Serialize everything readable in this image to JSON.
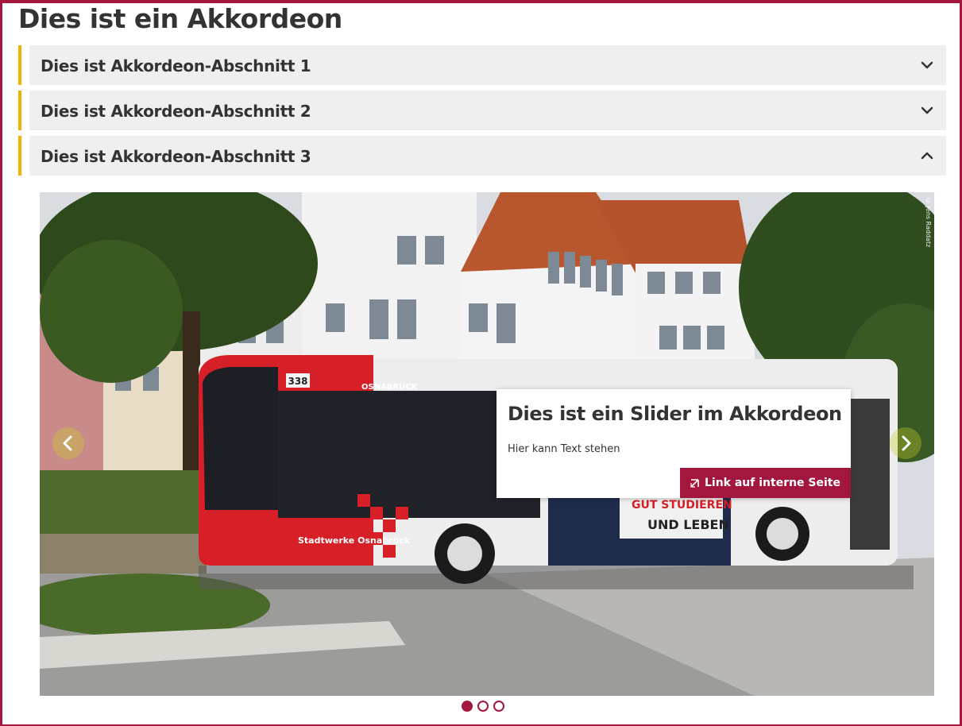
{
  "page": {
    "title": "Dies ist ein Akkordeon"
  },
  "accordion": {
    "items": [
      {
        "label": "Dies ist Akkordeon-Abschnitt 1",
        "state": "collapsed",
        "icon": "chevron-down-icon"
      },
      {
        "label": "Dies ist Akkordeon-Abschnitt 2",
        "state": "collapsed",
        "icon": "chevron-down-icon"
      },
      {
        "label": "Dies ist Akkordeon-Abschnitt 3",
        "state": "expanded",
        "icon": "chevron-up-icon"
      }
    ]
  },
  "slider": {
    "image_subject": "red and white articulated city bus in front of buildings",
    "photo_credit": "© Jens Raddatz",
    "bus_route_number": "338",
    "bus_operator_text": "OSNABRÜCK",
    "bus_ad_text_1": "GUT STUDIEREN",
    "bus_ad_text_2": "UND LEBEN",
    "bus_side_logo": "Stadtwerke Osnabrück",
    "caption": {
      "title": "Dies ist ein Slider im Akkordeon",
      "text": "Hier kann Text stehen",
      "link_label": "Link auf interne Seite"
    },
    "slides_total": 3,
    "active_slide": 1
  },
  "colors": {
    "brand": "#a3173f",
    "accent": "#f0b400",
    "accordion_bg": "#efefef",
    "text": "#333333"
  }
}
